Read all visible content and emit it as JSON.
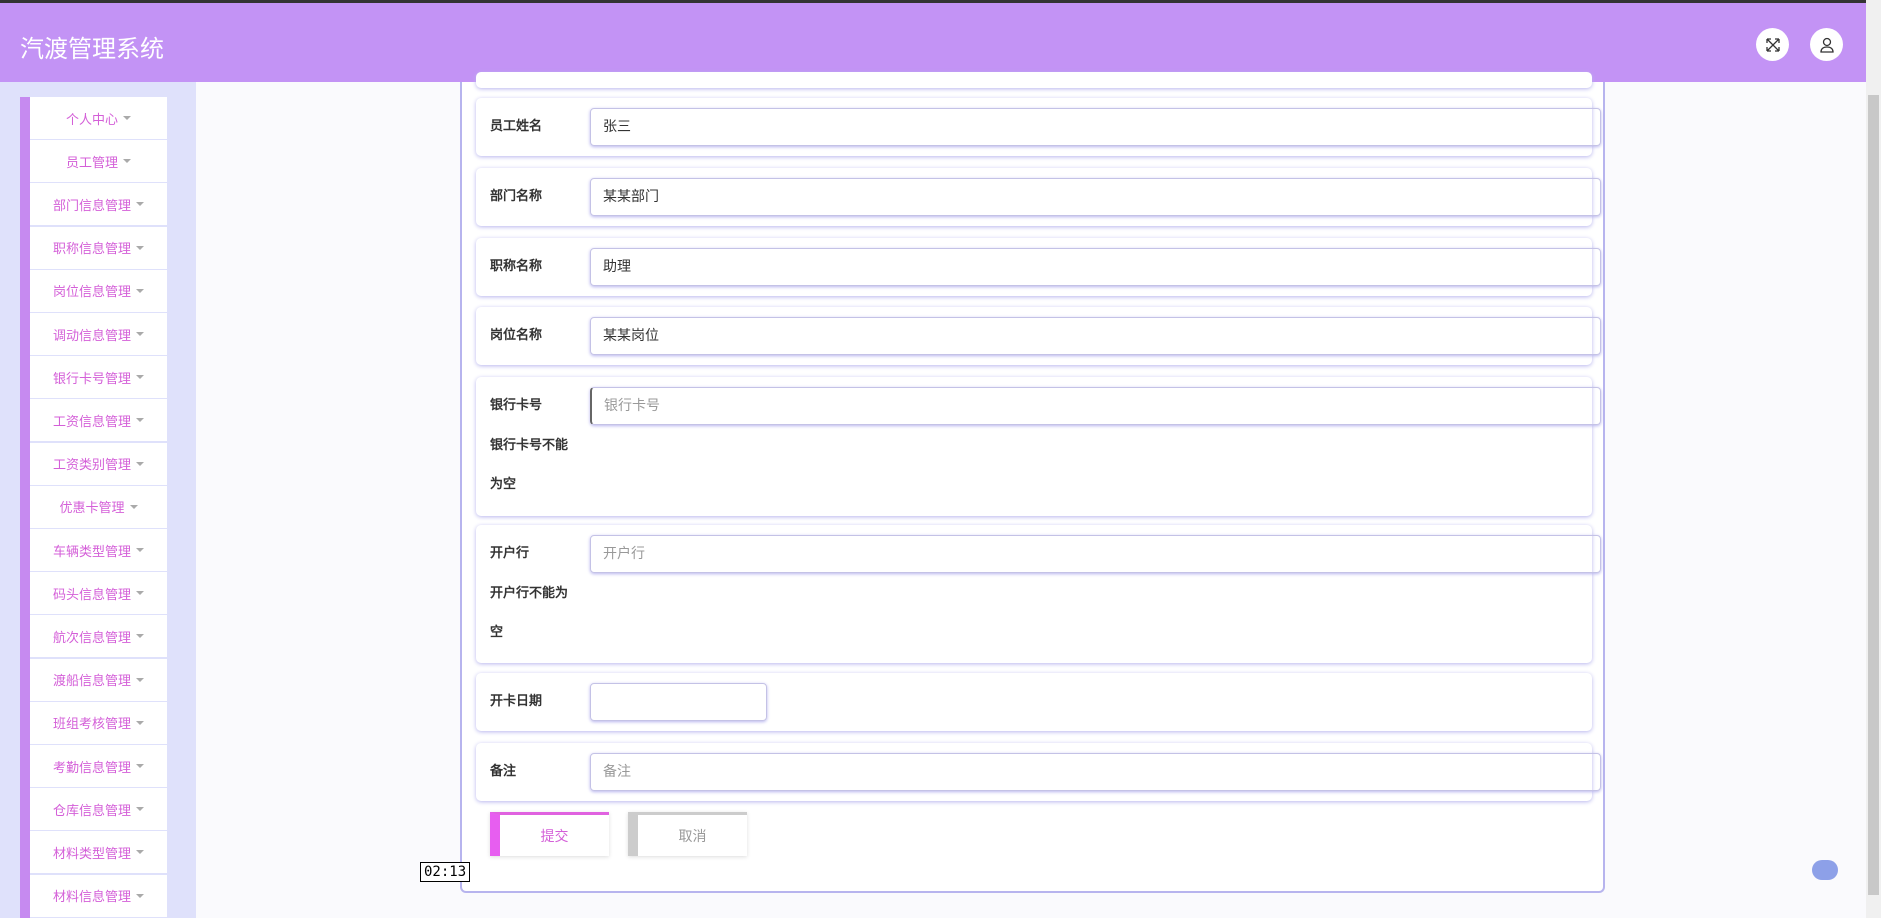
{
  "header": {
    "title": "汽渡管理系统",
    "fullscreen_icon": "expand-icon",
    "user_icon": "user-icon"
  },
  "sidebar": {
    "items": [
      "个人中心",
      "员工管理",
      "部门信息管理",
      "职称信息管理",
      "岗位信息管理",
      "调动信息管理",
      "银行卡号管理",
      "工资信息管理",
      "工资类别管理",
      "优惠卡管理",
      "车辆类型管理",
      "码头信息管理",
      "航次信息管理",
      "渡船信息管理",
      "班组考核管理",
      "考勤信息管理",
      "仓库信息管理",
      "材料类型管理",
      "材料信息管理"
    ]
  },
  "form": {
    "employee_name": {
      "label": "员工姓名",
      "value": "张三"
    },
    "department": {
      "label": "部门名称",
      "value": "某某部门"
    },
    "title": {
      "label": "职称名称",
      "value": "助理"
    },
    "position": {
      "label": "岗位名称",
      "value": "某某岗位"
    },
    "bank_card": {
      "label": "银行卡号",
      "placeholder": "银行卡号",
      "error_1": "银行卡号不能",
      "error_2": "为空"
    },
    "bank": {
      "label": "开户行",
      "placeholder": "开户行",
      "error_1": "开户行不能为",
      "error_2": "空"
    },
    "open_date": {
      "label": "开卡日期",
      "value": ""
    },
    "remark": {
      "label": "备注",
      "placeholder": "备注"
    },
    "submit": "提交",
    "cancel": "取消"
  },
  "tooltip": "02:13",
  "colors": {
    "header": "#c393f5",
    "accent": "#d45fd8"
  }
}
